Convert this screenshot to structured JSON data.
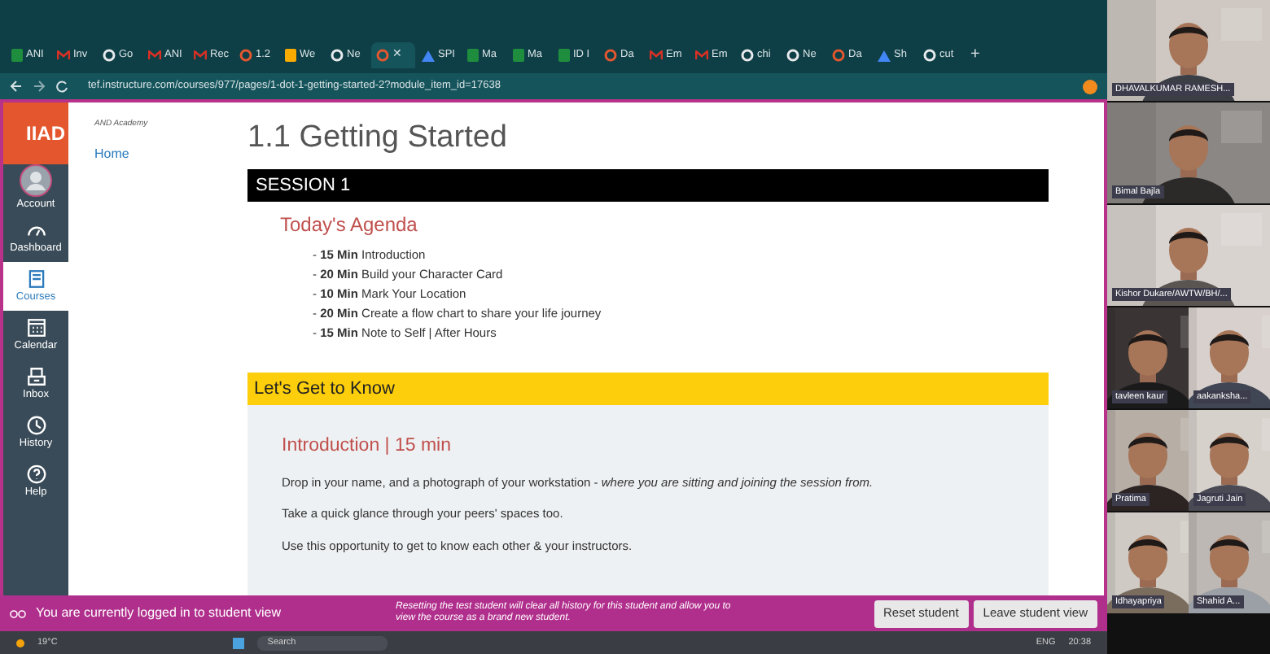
{
  "browser": {
    "tabs": [
      {
        "kind": "sheets",
        "label": "ANI",
        "selected": false
      },
      {
        "kind": "mail",
        "label": "Inv",
        "selected": false
      },
      {
        "kind": "globe",
        "label": "Go",
        "selected": false
      },
      {
        "kind": "mail",
        "label": "ANI",
        "selected": false
      },
      {
        "kind": "mail",
        "label": "Rec",
        "selected": false
      },
      {
        "kind": "canvas",
        "label": "1.2",
        "selected": false
      },
      {
        "kind": "note",
        "label": "We",
        "selected": false
      },
      {
        "kind": "globe",
        "label": "Ne",
        "selected": false
      },
      {
        "kind": "canvas",
        "selected": true
      },
      {
        "kind": "drive",
        "label": "SPI",
        "selected": false
      },
      {
        "kind": "sheets",
        "label": "Ma",
        "selected": false
      },
      {
        "kind": "sheets",
        "label": "Ma",
        "selected": false
      },
      {
        "kind": "sheets",
        "label": "ID I",
        "selected": false
      },
      {
        "kind": "canvas",
        "label": "Da",
        "selected": false
      },
      {
        "kind": "mail",
        "label": "Em",
        "selected": false
      },
      {
        "kind": "mail",
        "label": "Em",
        "selected": false
      },
      {
        "kind": "globe",
        "label": "chi",
        "selected": false
      },
      {
        "kind": "globe",
        "label": "Ne",
        "selected": false
      },
      {
        "kind": "canvas",
        "label": "Da",
        "selected": false
      },
      {
        "kind": "drive",
        "label": "Sh",
        "selected": false
      },
      {
        "kind": "globe",
        "label": "cut",
        "selected": false
      }
    ],
    "close_glyph": "✕",
    "new_tab_glyph": "+",
    "url": "tef.instructure.com/courses/977/pages/1-dot-1-getting-started-2?module_item_id=17638"
  },
  "nav": {
    "logo": "IIAD",
    "items": [
      {
        "kind": "account",
        "label": "Account",
        "selected": false
      },
      {
        "kind": "dashboard",
        "label": "Dashboard",
        "selected": false
      },
      {
        "kind": "courses",
        "label": "Courses",
        "selected": true
      },
      {
        "kind": "calendar",
        "label": "Calendar",
        "selected": false
      },
      {
        "kind": "inbox",
        "label": "Inbox",
        "selected": false
      },
      {
        "kind": "history",
        "label": "History",
        "selected": false
      },
      {
        "kind": "help",
        "label": "Help",
        "selected": false
      }
    ]
  },
  "course_menu": {
    "title": "AND Academy",
    "links": [
      "Home"
    ]
  },
  "page": {
    "title": "1.1 Getting Started",
    "session": "SESSION 1",
    "agenda_title": "Today's Agenda",
    "agenda": [
      "- **15 Min** Introduction",
      "- **20 Min** Build your Character Card",
      "- **10 Min** Mark Your Location",
      "- **20 Min** Create a flow chart to share your life journey",
      "- **15 Min** Note to Self | After Hours"
    ],
    "section": "Let's Get to Know",
    "intro_title": "Introduction | 15 min",
    "paragraphs": [
      "Drop in your name, and a photograph of your workstation - *where you are sitting and joining the session from.*",
      "Take a quick glance through your peers' spaces too.",
      "Use this opportunity to get to know each other & your instructors."
    ]
  },
  "student_banner": {
    "message": "You are currently logged in to student view",
    "note": "Resetting the test student will clear all history for this student and allow you to view the course as a brand new student.",
    "buttons": [
      "Reset student",
      "Leave student view"
    ]
  },
  "taskbar": {
    "weather": "19°C",
    "search": "Search",
    "language": "ENG",
    "time": "20:38"
  },
  "participants": [
    {
      "name": "DHAVALKUMAR RAMESH...",
      "wide": true
    },
    {
      "name": "Bimal Bajla",
      "wide": true
    },
    {
      "name": "Kishor Dukare/AWTW/BH/...",
      "wide": true
    },
    {
      "name": "tavleen kaur",
      "wide": false
    },
    {
      "name": "aakanksha...",
      "wide": false
    },
    {
      "name": "Pratima",
      "wide": false
    },
    {
      "name": "Jagruti Jain",
      "wide": false
    },
    {
      "name": "Idhayapriya",
      "wide": false
    },
    {
      "name": "Shahid A...",
      "wide": false
    }
  ]
}
